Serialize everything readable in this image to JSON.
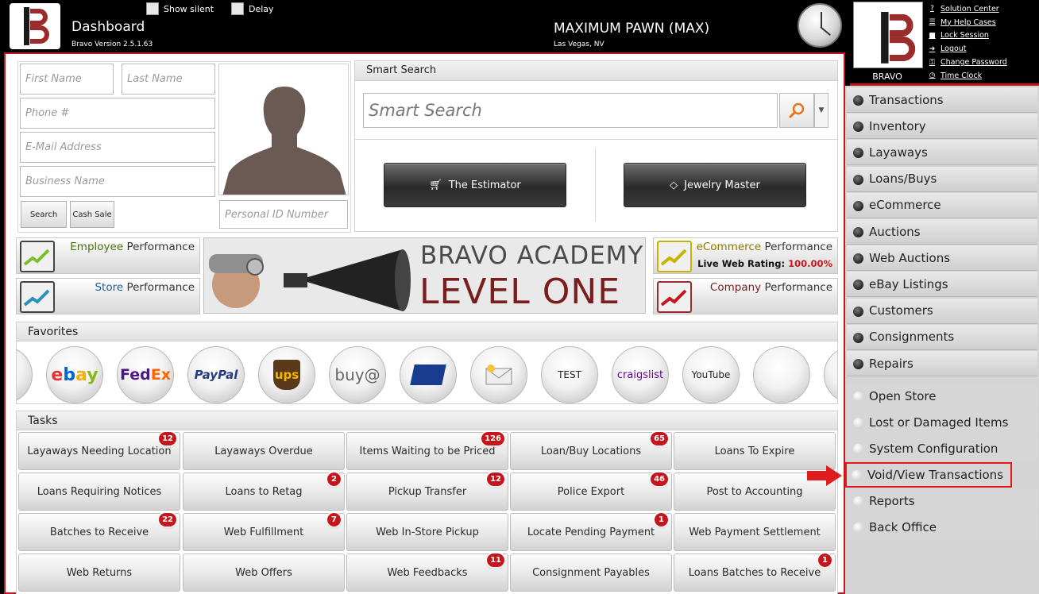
{
  "header": {
    "title": "Dashboard",
    "version": "Bravo Version 2.5.1.63",
    "show_silent": "Show silent",
    "delay": "Delay",
    "store_name": "MAXIMUM PAWN (MAX)",
    "store_location": "Las Vegas, NV"
  },
  "brand": {
    "name": "BRAVO",
    "links": [
      {
        "label": "Solution Center",
        "icon": "help-icon"
      },
      {
        "label": "My Help Cases",
        "icon": "list-icon"
      },
      {
        "label": "Lock Session",
        "icon": "lock-icon"
      },
      {
        "label": "Logout",
        "icon": "logout-icon"
      },
      {
        "label": "Change Password",
        "icon": "key-icon"
      },
      {
        "label": "Time Clock",
        "icon": "clock-icon"
      }
    ]
  },
  "customer": {
    "first_name_ph": "First Name",
    "last_name_ph": "Last Name",
    "phone_ph": "Phone #",
    "email_ph": "E-Mail Address",
    "business_ph": "Business Name",
    "personal_id_ph": "Personal ID Number",
    "search_btn": "Search",
    "cash_sale_btn": "Cash Sale"
  },
  "smart_search": {
    "heading": "Smart Search",
    "placeholder": "Smart Search",
    "estimator": "The Estimator",
    "jewelry": "Jewelry Master"
  },
  "performance": {
    "employee": {
      "highlight": "Employee",
      "rest": " Performance"
    },
    "store": {
      "highlight": "Store",
      "rest": " Performance"
    },
    "ecommerce": {
      "highlight": "eCommerce",
      "rest": " Performance",
      "rating_label": "Live Web Rating: ",
      "rating_value": "100.00%"
    },
    "company": {
      "highlight": "Company",
      "rest": " Performance"
    }
  },
  "banner": {
    "line1": "BRAVO ACADEMY",
    "line2": "LEVEL ONE"
  },
  "favorites": {
    "heading": "Favorites",
    "items": [
      {
        "label": "ebay",
        "icon": "ebay-icon"
      },
      {
        "label": "FedEx",
        "icon": "fedex-icon"
      },
      {
        "label": "PayPal",
        "icon": "paypal-icon"
      },
      {
        "label": "ups",
        "icon": "ups-icon"
      },
      {
        "label": "buy@",
        "icon": "buya-icon"
      },
      {
        "label": "",
        "icon": "usps-icon"
      },
      {
        "label": "",
        "icon": "mail-icon"
      },
      {
        "label": "TEST",
        "icon": "test-icon"
      },
      {
        "label": "craigslist",
        "icon": "craigslist-icon"
      },
      {
        "label": "YouTube",
        "icon": "youtube-icon"
      }
    ]
  },
  "tasks": {
    "heading": "Tasks",
    "items": [
      {
        "label": "Layaways Needing Location",
        "badge": "12"
      },
      {
        "label": "Layaways Overdue",
        "badge": ""
      },
      {
        "label": "Items Waiting to be Priced",
        "badge": "126"
      },
      {
        "label": "Loan/Buy Locations",
        "badge": "65"
      },
      {
        "label": "Loans To Expire",
        "badge": ""
      },
      {
        "label": "Loans Requiring Notices",
        "badge": ""
      },
      {
        "label": "Loans to Retag",
        "badge": "2"
      },
      {
        "label": "Pickup Transfer",
        "badge": "12"
      },
      {
        "label": "Police Export",
        "badge": "46"
      },
      {
        "label": "Post to Accounting",
        "badge": ""
      },
      {
        "label": "Batches to Receive",
        "badge": "22"
      },
      {
        "label": "Web Fulfillment",
        "badge": "7"
      },
      {
        "label": "Web In-Store Pickup",
        "badge": ""
      },
      {
        "label": "Locate Pending Payment",
        "badge": "1"
      },
      {
        "label": "Web Payment Settlement",
        "badge": ""
      },
      {
        "label": "Web Returns",
        "badge": ""
      },
      {
        "label": "Web Offers",
        "badge": ""
      },
      {
        "label": "Web Feedbacks",
        "badge": "11"
      },
      {
        "label": "Consignment Payables",
        "badge": ""
      },
      {
        "label": "Loans Batches to Receive",
        "badge": "1"
      }
    ]
  },
  "nav": {
    "main": [
      "Transactions",
      "Inventory",
      "Layaways",
      "Loans/Buys",
      "eCommerce",
      "Auctions",
      "Web Auctions",
      "eBay Listings",
      "Customers",
      "Consignments",
      "Repairs"
    ],
    "secondary": [
      "Open Store",
      "Lost or Damaged Items",
      "System Configuration",
      "Void/View Transactions",
      "Reports",
      "Back Office"
    ]
  },
  "colors": {
    "accent_red": "#c4161c",
    "highlight_red": "#e01b1b",
    "header_bg": "#000000"
  }
}
